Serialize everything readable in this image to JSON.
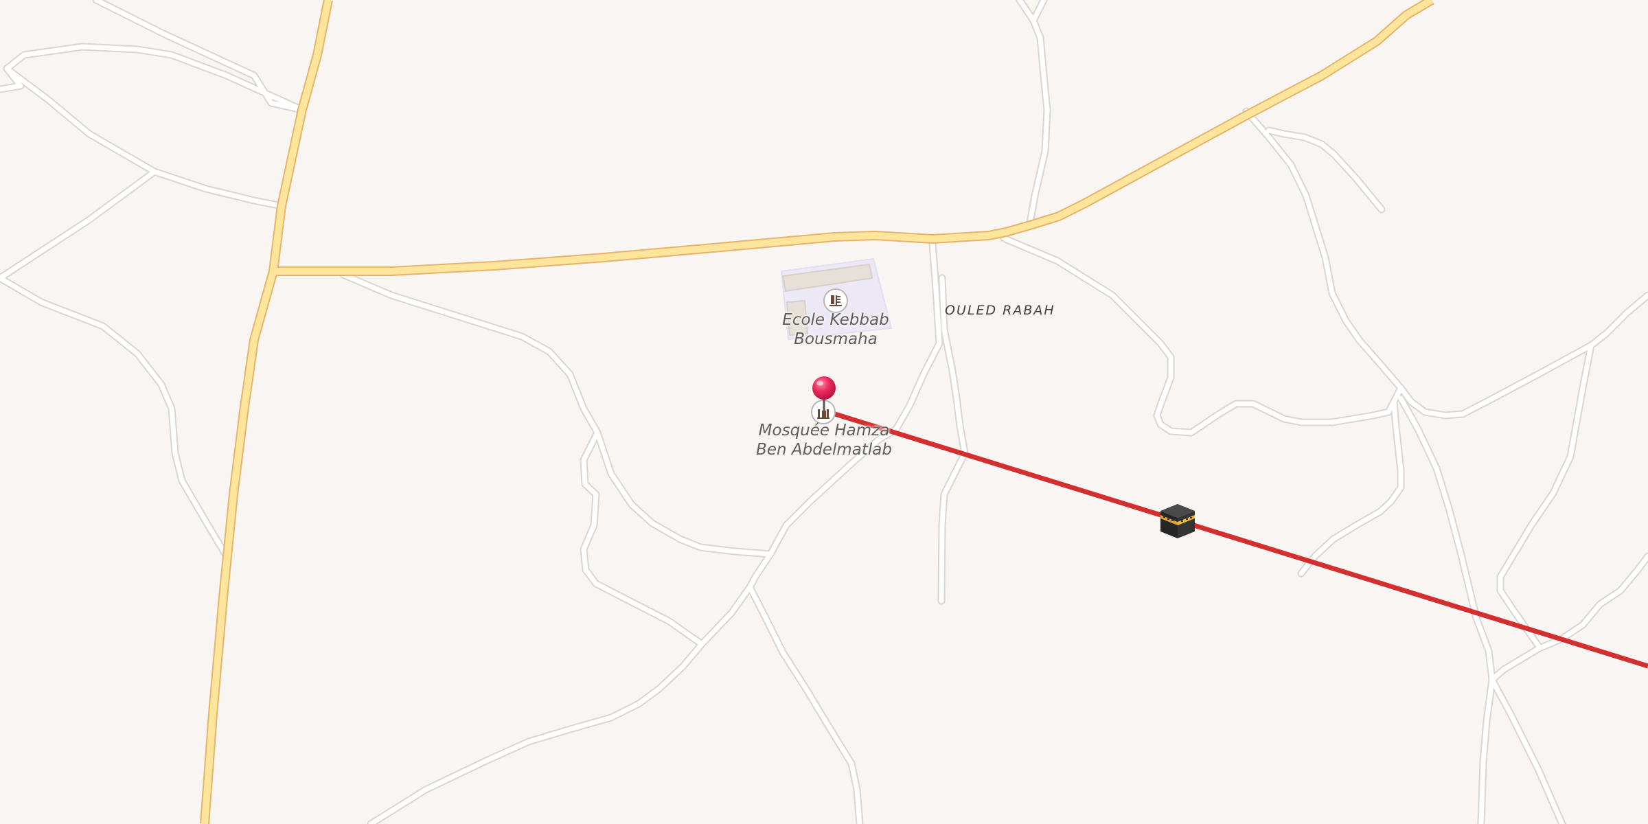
{
  "map": {
    "poi_school": {
      "name_line1": "Ecole Kebbab",
      "name_line2": "Bousmaha",
      "icon": "school-icon"
    },
    "poi_mosque": {
      "name_line1": "Mosquée Hamza",
      "name_line2": "Ben Abdelmatlab",
      "icon": "mosque-icon"
    },
    "locality": {
      "name": "OULED RABAH"
    },
    "markers": {
      "location_pin": {
        "icon": "location-pin-icon",
        "color": "#e8245a"
      },
      "qibla_marker": {
        "icon": "kaaba-icon"
      }
    },
    "qibla_line": {
      "color": "#d32f2f"
    },
    "colors": {
      "background": "#f8f5f2",
      "primary_road_fill": "#fde59c",
      "primary_road_casing": "#e6b46a",
      "minor_road_fill": "#ffffff",
      "minor_road_casing": "#dad5d1",
      "school_area": "#ece8f6"
    }
  }
}
